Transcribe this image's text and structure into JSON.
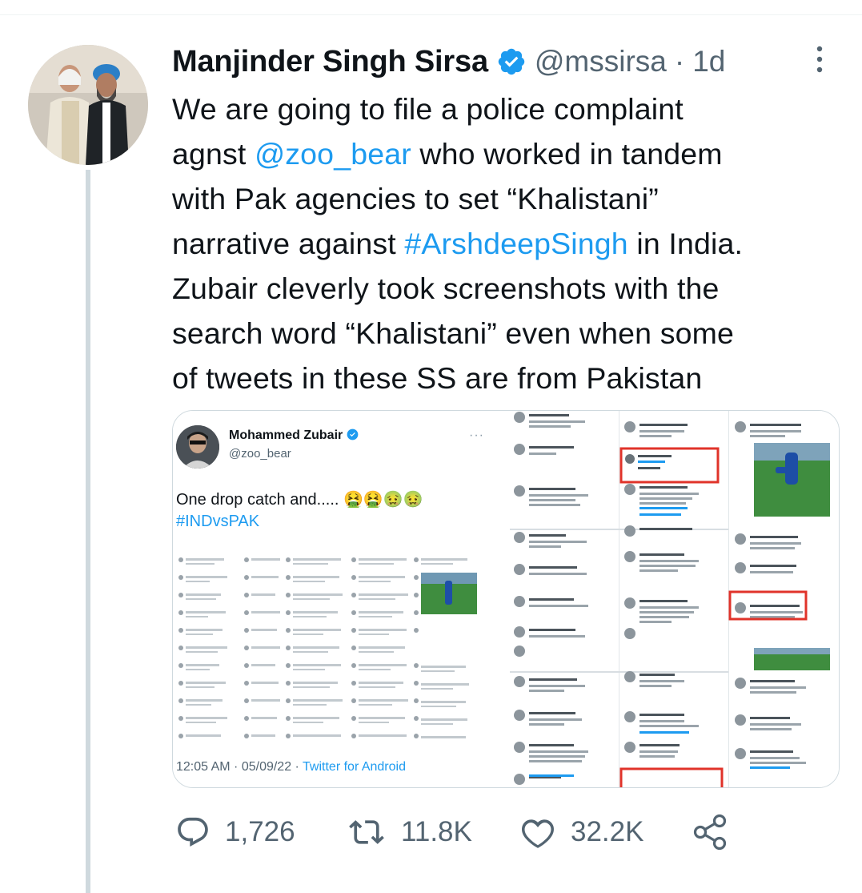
{
  "tweet": {
    "author_name": "Manjinder Singh Sirsa",
    "handle": "@mssirsa",
    "separator": "·",
    "time": "1d",
    "text_parts": [
      "We are going to file a police complaint\nagnst ",
      "@zoo_bear",
      " who worked in tandem\nwith Pak agencies to set “Khalistani”\nnarrative against ",
      "#ArshdeepSingh",
      " in India.\nZubair cleverly took screenshots with the\nsearch word “Khalistani” even when some\nof tweets in these SS are from Pakistan"
    ]
  },
  "media": {
    "left": {
      "name": "Mohammed Zubair",
      "handle": "@zoo_bear",
      "more": "···",
      "text": "One drop catch and.....",
      "emojis": "🤮🤮🤢🤢",
      "hashtag": "#INDvsPAK",
      "footer_time": "12:05 AM · 05/09/22 · ",
      "footer_source": "Twitter for Android"
    }
  },
  "actions": {
    "replies": "1,726",
    "retweets": "11.8K",
    "likes": "32.2K"
  },
  "colors": {
    "link": "#1d9bf0",
    "secondary_text": "#536471",
    "verified": "#1d9bf0",
    "thread_line": "#cfd9de",
    "highlight_box": "#e0332a"
  }
}
